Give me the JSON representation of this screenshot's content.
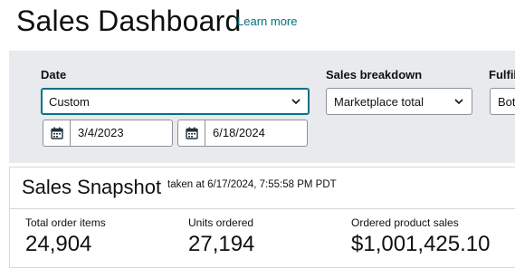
{
  "header": {
    "title": "Sales Dashboard",
    "learn_more": "Learn more"
  },
  "filters": {
    "date": {
      "label": "Date",
      "selected": "Custom",
      "start_date": "3/4/2023",
      "end_date": "6/18/2024"
    },
    "sales_breakdown": {
      "label": "Sales breakdown",
      "selected": "Marketplace total"
    },
    "fulfillment": {
      "label": "Fulfil",
      "selected": "Bot"
    }
  },
  "snapshot": {
    "title": "Sales Snapshot",
    "timestamp": "taken at 6/17/2024, 7:55:58 PM PDT",
    "metrics": [
      {
        "label": "Total order items",
        "value": "24,904"
      },
      {
        "label": "Units ordered",
        "value": "27,194"
      },
      {
        "label": "Ordered product sales",
        "value": "$1,001,425.10"
      }
    ]
  },
  "colors": {
    "link": "#007185",
    "panel_bg": "#e8eaee",
    "focus_border": "#007185"
  },
  "icons": [
    "chevron-down-icon",
    "calendar-icon"
  ]
}
